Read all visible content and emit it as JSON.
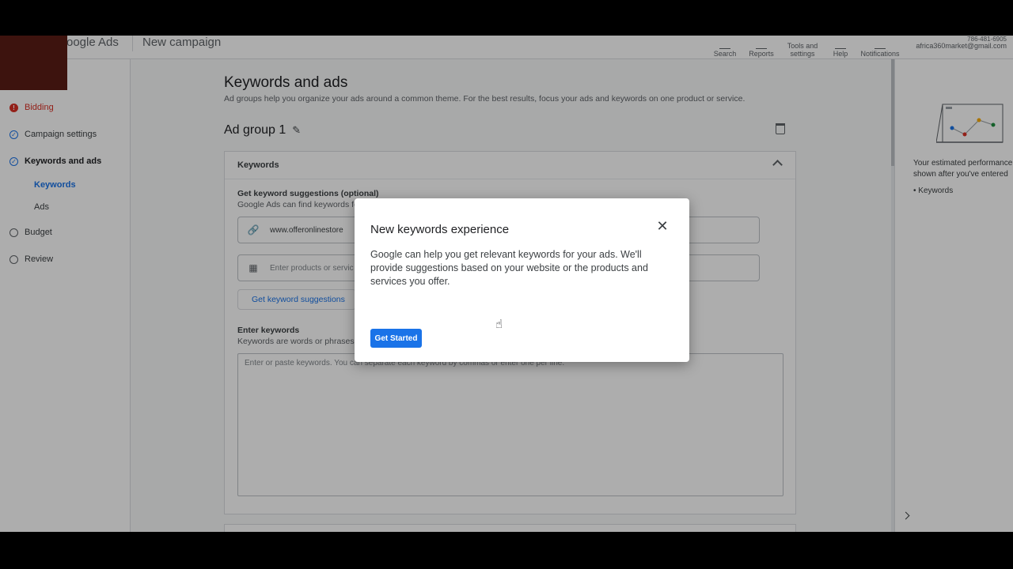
{
  "header": {
    "logo": "oogle Ads",
    "title": "New campaign",
    "nav": [
      {
        "label": "Search"
      },
      {
        "label": "Reports"
      },
      {
        "label": "Tools and settings"
      },
      {
        "label": "Help"
      },
      {
        "label": "Notifications"
      }
    ],
    "account_number": "786-481-6905",
    "account_email": "africa360market@gmail.com"
  },
  "sidebar": {
    "items": [
      {
        "label": "Bidding",
        "status": "error"
      },
      {
        "label": "Campaign settings",
        "status": "done"
      },
      {
        "label": "Keywords and ads",
        "status": "done"
      },
      {
        "label": "Keywords",
        "status": "sub-active"
      },
      {
        "label": "Ads",
        "status": "sub"
      },
      {
        "label": "Budget",
        "status": "pending"
      },
      {
        "label": "Review",
        "status": "pending"
      }
    ]
  },
  "main": {
    "title": "Keywords and ads",
    "subtitle": "Ad groups help you organize your ads around a common theme. For the best results, focus your ads and keywords on one product or service.",
    "ad_group": "Ad group 1",
    "card_title": "Keywords",
    "suggestions_label": "Get keyword suggestions (optional)",
    "suggestions_sub": "Google Ads can find keywords fo",
    "url_value": "www.offeronlinestore",
    "products_placeholder": "Enter products or servic",
    "suggest_button": "Get keyword suggestions",
    "enter_label": "Enter keywords",
    "enter_sub": "Keywords are words or phrases t",
    "keywords_placeholder": "Enter or paste keywords. You can separate each keyword by commas or enter one per line."
  },
  "right_panel": {
    "perf_line1": "Your estimated performance",
    "perf_line2": "shown after you've entered",
    "bullet": "Keywords"
  },
  "dialog": {
    "title": "New keywords experience",
    "body": "Google can help you get relevant keywords for your ads. We'll provide suggestions based on your website or the products and services you offer.",
    "button": "Get Started",
    "close_glyph": "✕"
  },
  "colors": {
    "accent": "#1a73e8",
    "error": "#d93025"
  }
}
